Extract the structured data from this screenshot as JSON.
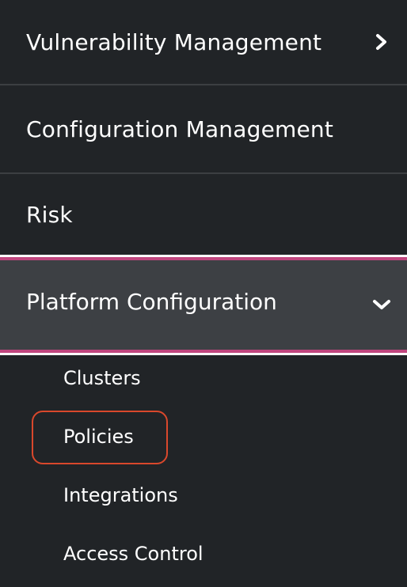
{
  "nav": {
    "items": [
      {
        "label": "Vulnerability Management",
        "icon": "chevron-right-icon"
      },
      {
        "label": "Configuration Management"
      },
      {
        "label": "Risk"
      }
    ],
    "expanded": {
      "label": "Platform Configuration",
      "icon": "chevron-down-icon",
      "children": [
        {
          "label": "Clusters"
        },
        {
          "label": "Policies"
        },
        {
          "label": "Integrations"
        },
        {
          "label": "Access Control"
        }
      ]
    }
  },
  "colors": {
    "background": "#212427",
    "expanded_background": "#3d4044",
    "accent_pink": "#c0467e",
    "highlight_outline": "#d9482c",
    "divider": "#3c3f42",
    "text": "#ffffff"
  }
}
